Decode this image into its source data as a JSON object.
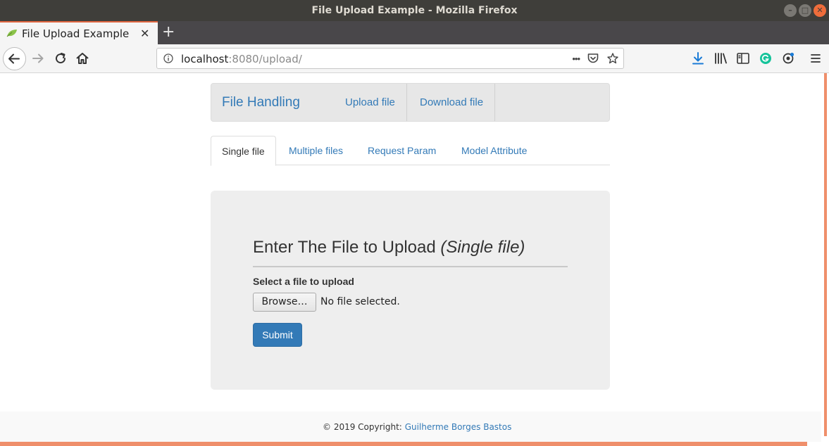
{
  "window": {
    "title": "File Upload Example - Mozilla Firefox",
    "controls": {
      "minimize": "–",
      "maximize": "□",
      "close": "✕"
    }
  },
  "browser": {
    "tab_title": "File Upload Example",
    "tab_close": "✕",
    "new_tab": "+",
    "url_host": "localhost",
    "url_rest": ":8080/upload/",
    "more_actions": "•••"
  },
  "app": {
    "brand": "File Handling",
    "nav": [
      {
        "label": "Upload file"
      },
      {
        "label": "Download file"
      }
    ],
    "tabs": [
      {
        "label": "Single file",
        "active": true
      },
      {
        "label": "Multiple files"
      },
      {
        "label": "Request Param"
      },
      {
        "label": "Model Attribute"
      }
    ],
    "form": {
      "title": "Enter The File to Upload",
      "title_suffix": "(Single file)",
      "file_label": "Select a file to upload",
      "browse_label": "Browse…",
      "file_status": "No file selected.",
      "submit_label": "Submit"
    },
    "footer": {
      "copyright": "© 2019 Copyright:",
      "author": "Guilherme Borges Bastos"
    }
  },
  "colors": {
    "accent": "#ef6d3b",
    "link": "#337ab7",
    "titlebar": "#3f3e3a"
  }
}
